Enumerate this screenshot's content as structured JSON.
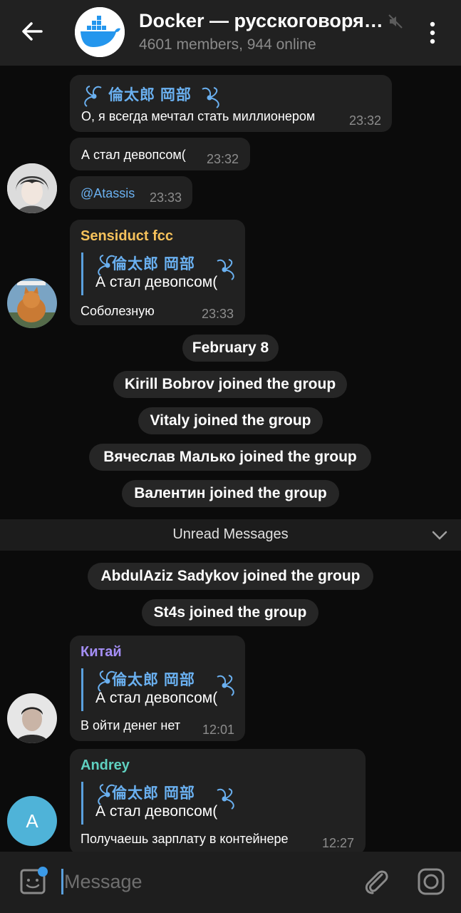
{
  "header": {
    "title": "Docker — русскоговорящее сообщество",
    "subtitle": "4601 members, 944 online",
    "avatar_icon": "docker-whale-logo",
    "mute_icon": "muted-speaker-icon"
  },
  "messages": [
    {
      "reply_name": "倫太郎 岡部",
      "text": "О, я всегда мечтал стать миллионером",
      "time": "23:32"
    },
    {
      "text": "А стал девопсом(",
      "time": "23:32"
    },
    {
      "text": "@Atassis",
      "time": "23:33"
    },
    {
      "sender": "Sensiduct fcc",
      "sender_color": "#f6c25b",
      "reply_name": "倫太郎 岡部",
      "reply_text": "А стал девопсом(",
      "text": "Соболезную",
      "time": "23:33"
    },
    {
      "sender": "Китай",
      "sender_color": "#a48ef5",
      "reply_name": "倫太郎 岡部",
      "reply_text": "А стал девопсом(",
      "text": "В ойти денег нет",
      "time": "12:01"
    },
    {
      "sender": "Andrey",
      "sender_color": "#5fd0c0",
      "reply_name": "倫太郎 岡部",
      "reply_text": "А стал девопсом(",
      "text": "Получаешь зарплату в контейнере",
      "time": "12:27",
      "avatar_letter": "A",
      "avatar_color": "#4fb3d8"
    }
  ],
  "service": {
    "date": "February 8",
    "join1": "Kirill Bobrov joined the group",
    "join2": "Vitaly joined the group",
    "join3": "Вячеслав Малько joined the group",
    "join4": "Валентин joined the group",
    "join5": "AbdulAziz Sadykov joined the group",
    "join6": "St4s joined the group"
  },
  "unread_label": "Unread Messages",
  "input": {
    "placeholder": "Message"
  },
  "colors": {
    "link": "#6ab0f0",
    "reply_accent": "#5aa0dd",
    "bubble": "#212121"
  }
}
